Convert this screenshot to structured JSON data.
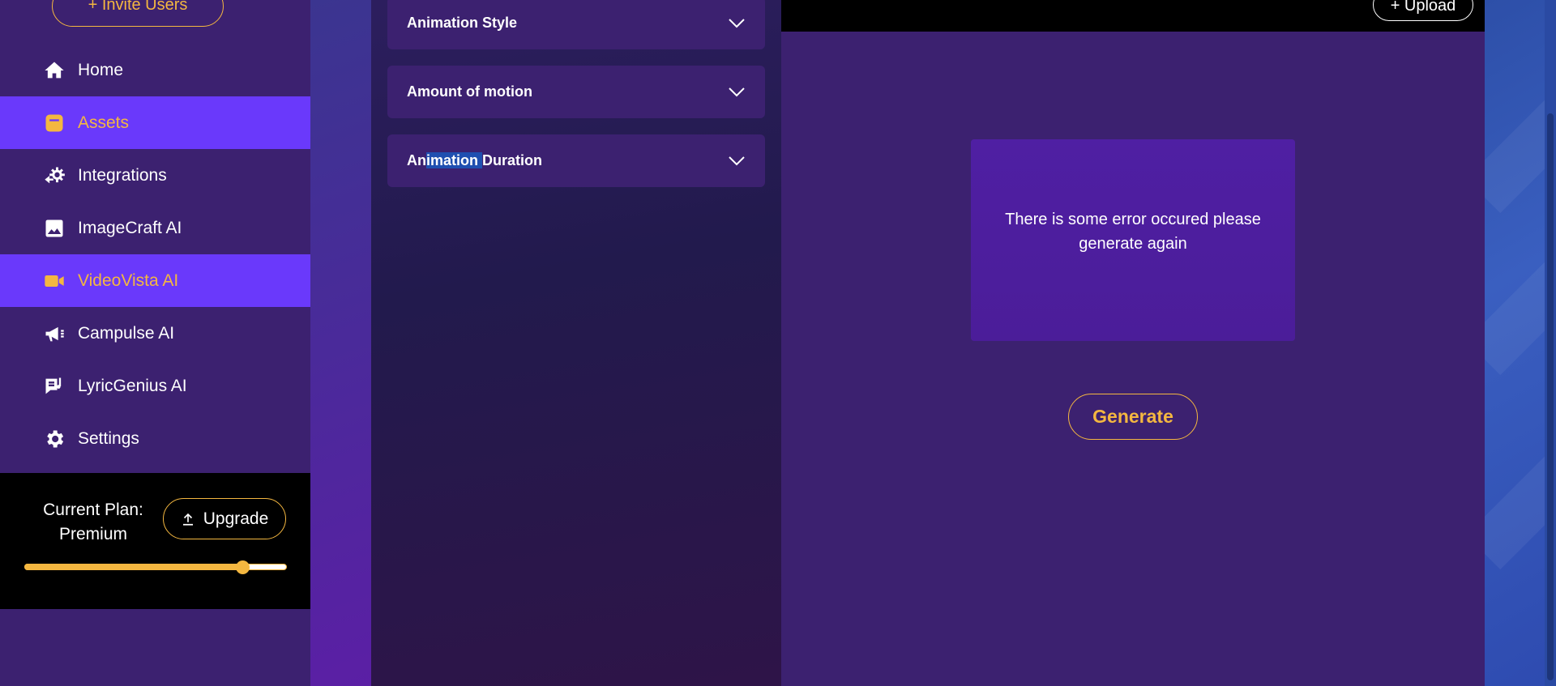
{
  "sidebar": {
    "invite_label": "+ Invite Users",
    "items": [
      {
        "label": "Home",
        "icon": "home-icon",
        "active": false
      },
      {
        "label": "Assets",
        "icon": "assets-icon",
        "active": true
      },
      {
        "label": "Integrations",
        "icon": "integrations-icon",
        "active": false
      },
      {
        "label": "ImageCraft AI",
        "icon": "image-icon",
        "active": false
      },
      {
        "label": "VideoVista AI",
        "icon": "video-icon",
        "active": true
      },
      {
        "label": "Campulse AI",
        "icon": "megaphone-icon",
        "active": false
      },
      {
        "label": "LyricGenius AI",
        "icon": "lyrics-icon",
        "active": false
      },
      {
        "label": "Settings",
        "icon": "gear-icon",
        "active": false
      }
    ],
    "plan": {
      "label_line1": "Current Plan:",
      "label_line2": "Premium",
      "upgrade_label": "Upgrade",
      "usage_fraction": 0.83
    }
  },
  "panel": {
    "accordions": [
      {
        "label": "Animation Style"
      },
      {
        "label": "Amount of motion"
      },
      {
        "label_prefix": "An",
        "label_highlight": "imation ",
        "label_suffix": "Duration"
      }
    ]
  },
  "main": {
    "upload_label": "+ Upload",
    "error_message": "There is some error occured please generate again",
    "generate_label": "Generate"
  },
  "colors": {
    "accent": "#f4b740",
    "active_bg": "#6a39fb",
    "panel_bg": "#3c2170"
  }
}
